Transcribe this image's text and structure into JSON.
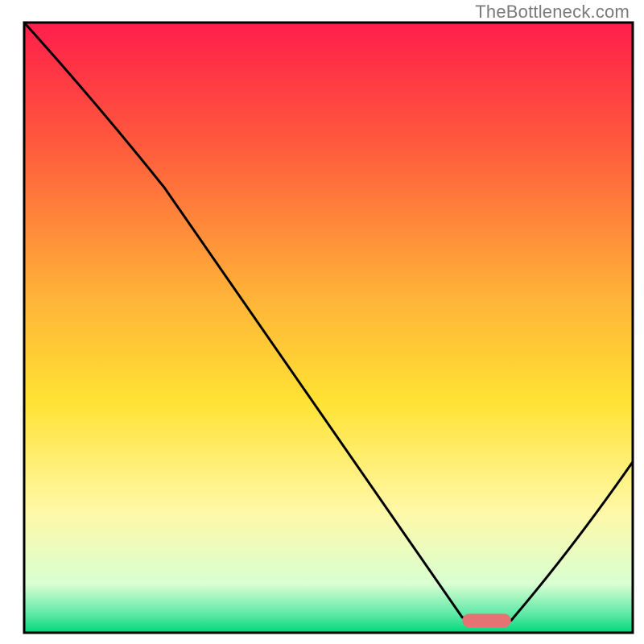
{
  "watermark": "TheBottleneck.com",
  "chart_data": {
    "type": "line",
    "title": "",
    "xlabel": "",
    "ylabel": "",
    "xlim": [
      0,
      100
    ],
    "ylim": [
      0,
      100
    ],
    "grid": false,
    "legend": false,
    "gradient_stops": [
      {
        "offset": 0,
        "color": "#ff1e4b"
      },
      {
        "offset": 20,
        "color": "#ff5a3d"
      },
      {
        "offset": 45,
        "color": "#ffb338"
      },
      {
        "offset": 62,
        "color": "#ffe233"
      },
      {
        "offset": 80,
        "color": "#fff8a6"
      },
      {
        "offset": 92,
        "color": "#d9ffd2"
      },
      {
        "offset": 97,
        "color": "#5de8a6"
      },
      {
        "offset": 100,
        "color": "#00d97a"
      }
    ],
    "series": [
      {
        "name": "bottleneck-curve",
        "color": "#000000",
        "points": [
          {
            "x": 0,
            "y": 100
          },
          {
            "x": 23,
            "y": 73
          },
          {
            "x": 72,
            "y": 2.5
          },
          {
            "x": 77,
            "y": 2
          },
          {
            "x": 80,
            "y": 2
          },
          {
            "x": 100,
            "y": 28
          }
        ]
      }
    ],
    "marker": {
      "color": "#e57373",
      "x_start": 72,
      "x_end": 80,
      "y": 2,
      "thickness": 2.2
    },
    "border_color": "#000000"
  }
}
